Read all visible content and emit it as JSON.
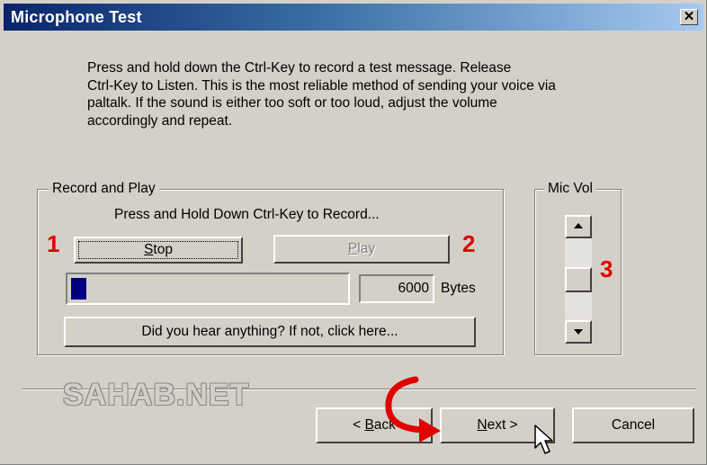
{
  "window": {
    "title": "Microphone Test",
    "close_glyph": "✕"
  },
  "instructions": "Press and hold down the Ctrl-Key to record a test message.  Release\nCtrl-Key to Listen. This is the most reliable method of sending your voice via\npaltalk.  If the sound is either too soft or too loud, adjust the volume\naccordingly and repeat.",
  "record_play": {
    "group_label": "Record and Play",
    "hint": "Press and Hold Down Ctrl-Key to Record...",
    "stop_button": {
      "pre": "",
      "underline": "S",
      "post": "top"
    },
    "play_button": {
      "pre": "",
      "underline": "P",
      "post": "lay",
      "enabled": false
    },
    "progress_fraction": 0.055,
    "bytes_value": "6000",
    "bytes_label": "Bytes",
    "hear_button": "Did you hear anything?  If not, click here..."
  },
  "mic_vol": {
    "group_label": "Mic Vol",
    "level_fraction": 0.5
  },
  "annotations": {
    "marker1": "1",
    "marker2": "2",
    "marker3": "3",
    "color": "#e00000"
  },
  "watermark": "SAHAB.NET",
  "footer": {
    "back_button": {
      "pre": "< ",
      "underline": "B",
      "post": "ack"
    },
    "next_button": {
      "pre": "",
      "underline": "N",
      "post": "ext >"
    },
    "cancel_button": "Cancel"
  },
  "colors": {
    "title_gradient_start": "#0a246a",
    "title_gradient_end": "#a6caf0",
    "face": "#d4d0c8",
    "progress_fill": "#000080",
    "annotation_red": "#e00000"
  },
  "icons": [
    "close-icon",
    "scroll-up-arrow-icon",
    "scroll-down-arrow-icon",
    "curved-arrow-icon",
    "mouse-cursor-icon"
  ]
}
